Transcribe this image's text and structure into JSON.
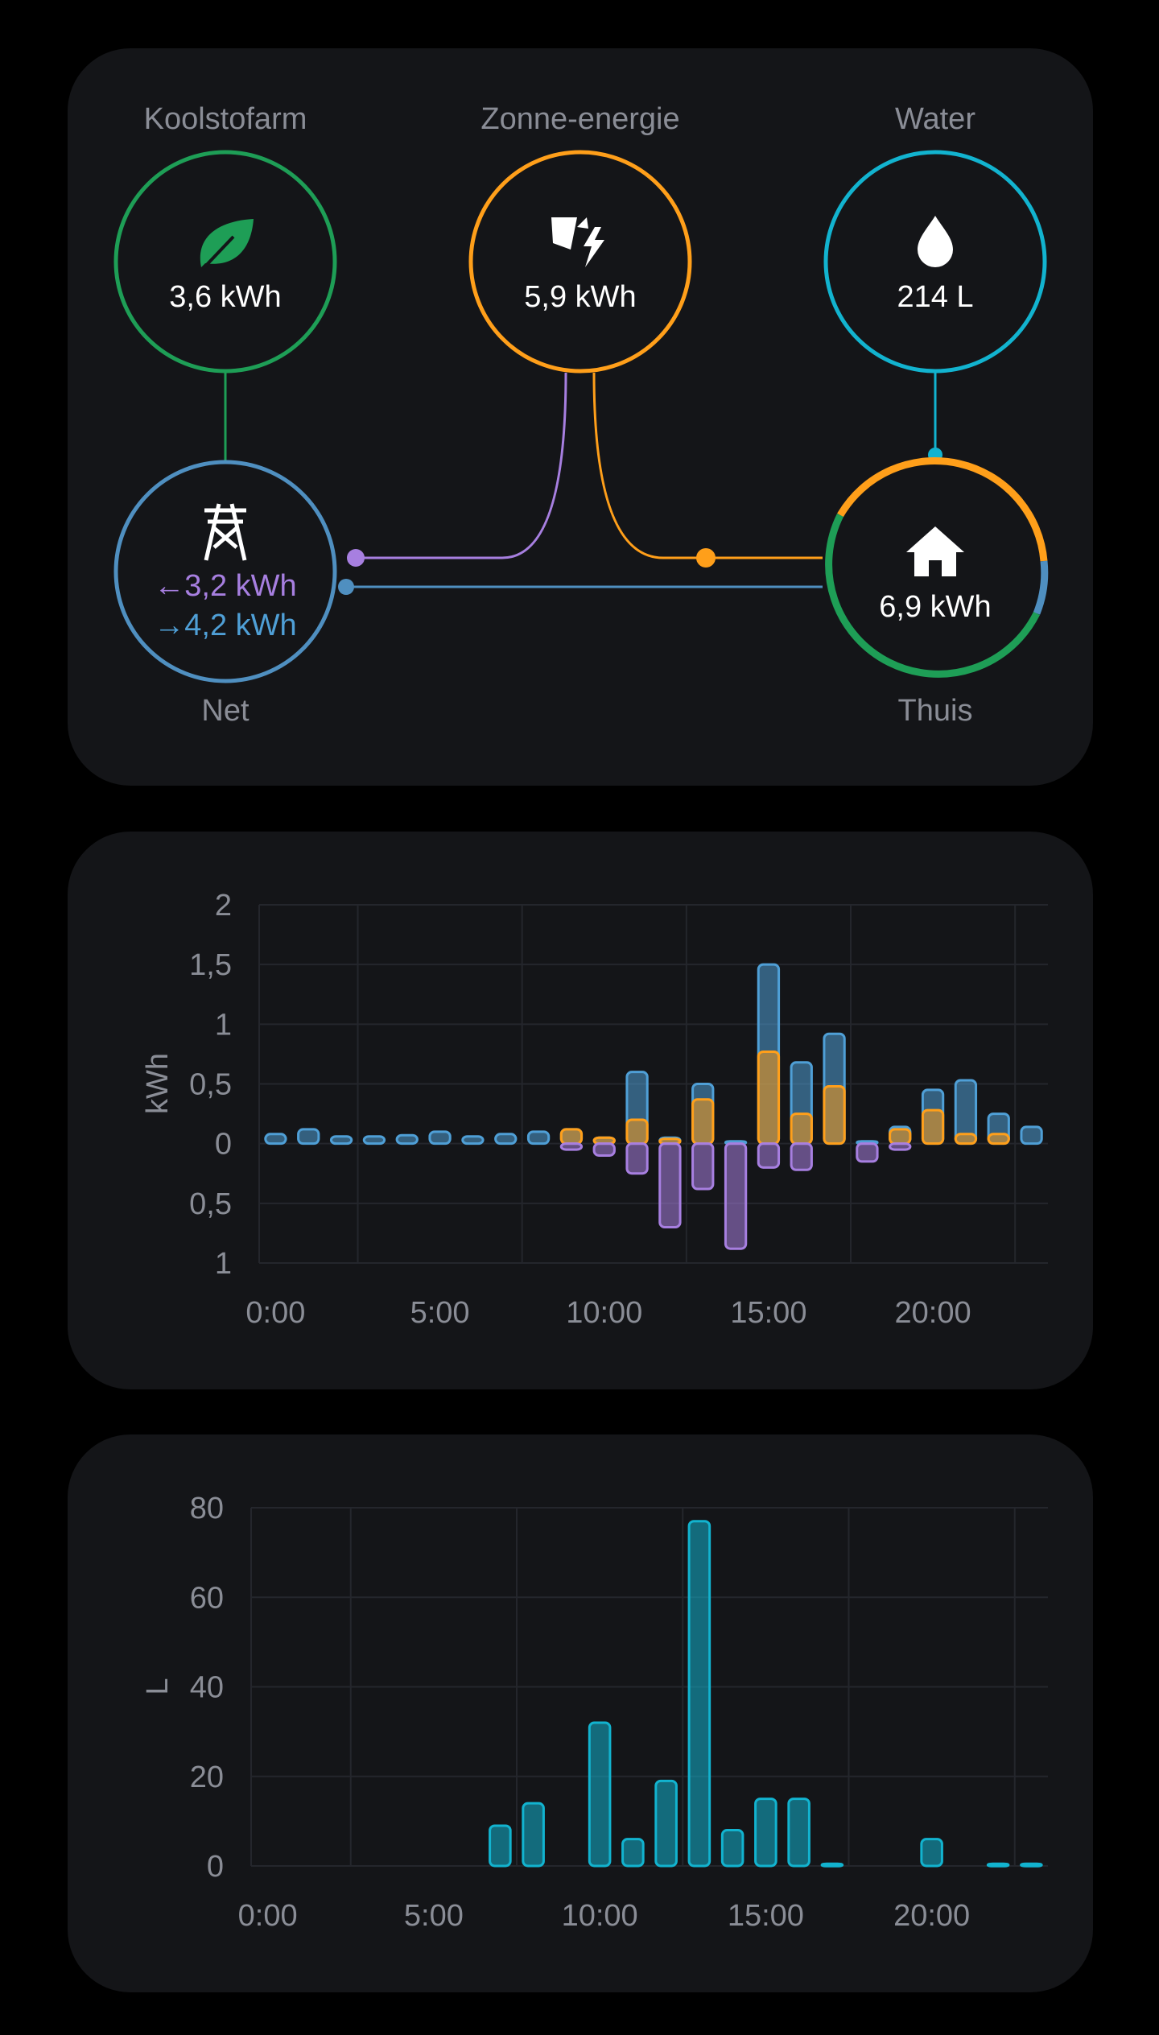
{
  "energy_flow": {
    "fossil": {
      "label": "Koolstofarm",
      "value": "3,6 kWh",
      "icon": "leaf-icon",
      "color": "#1e9e56"
    },
    "solar": {
      "label": "Zonne-energie",
      "value": "5,9 kWh",
      "icon": "solar-power-icon",
      "color": "#ff9f1a"
    },
    "water": {
      "label": "Water",
      "value": "214 L",
      "icon": "water-drop-icon",
      "color": "#12b3cf"
    },
    "grid": {
      "label": "Net",
      "import_arrow": "←",
      "import_value": "3,2 kWh",
      "export_arrow": "→",
      "export_value": "4,2 kWh",
      "icon": "transmission-tower-icon",
      "color": "#4f8fc0",
      "import_color": "#a77fe0",
      "export_color": "#4f9fd6"
    },
    "home": {
      "label": "Thuis",
      "value": "6,9 kWh",
      "icon": "home-icon"
    }
  },
  "chart_data": [
    {
      "type": "bar",
      "ylabel": "kWh",
      "x_tick_labels": [
        "0:00",
        "5:00",
        "10:00",
        "15:00",
        "20:00"
      ],
      "y_tick_labels": [
        "2",
        "1,5",
        "1",
        "0,5",
        "0",
        "0,5",
        "1"
      ],
      "ylim": [
        -1,
        2
      ],
      "categories": [
        0,
        1,
        2,
        3,
        4,
        5,
        6,
        7,
        8,
        9,
        10,
        11,
        12,
        13,
        14,
        15,
        16,
        17,
        18,
        19,
        20,
        21,
        22,
        23
      ],
      "series": [
        {
          "color": "#4f9fd6",
          "values": [
            0.08,
            0.12,
            0.06,
            0.06,
            0.07,
            0.1,
            0.06,
            0.08,
            0.1,
            0.12,
            0.05,
            0.6,
            0.05,
            0.5,
            0.02,
            1.5,
            0.68,
            0.92,
            0.02,
            0.14,
            0.45,
            0.53,
            0.25,
            0.14
          ]
        },
        {
          "color": "#ff9f1a",
          "values": [
            0,
            0,
            0,
            0,
            0,
            0,
            0,
            0,
            0,
            0.12,
            0.05,
            0.2,
            0.04,
            0.37,
            0,
            0.77,
            0.25,
            0.48,
            0,
            0.12,
            0.28,
            0.08,
            0.08,
            0
          ]
        },
        {
          "color": "#a77fe0",
          "values": [
            0,
            0,
            0,
            0,
            0,
            0,
            0,
            0,
            0,
            -0.05,
            -0.1,
            -0.25,
            -0.7,
            -0.38,
            -0.88,
            -0.2,
            -0.22,
            0,
            -0.15,
            -0.05,
            0,
            0,
            0,
            0
          ]
        }
      ],
      "grid": true
    },
    {
      "type": "bar",
      "ylabel": "L",
      "x_tick_labels": [
        "0:00",
        "5:00",
        "10:00",
        "15:00",
        "20:00"
      ],
      "y_tick_labels": [
        "80",
        "60",
        "40",
        "20",
        "0"
      ],
      "ylim": [
        0,
        80
      ],
      "categories": [
        0,
        1,
        2,
        3,
        4,
        5,
        6,
        7,
        8,
        9,
        10,
        11,
        12,
        13,
        14,
        15,
        16,
        17,
        18,
        19,
        20,
        21,
        22,
        23
      ],
      "series": [
        {
          "color": "#12b3cf",
          "values": [
            0,
            0,
            0,
            0,
            0,
            0,
            0,
            9,
            14,
            0,
            32,
            6,
            19,
            77,
            8,
            15,
            15,
            0.5,
            0,
            0,
            6,
            0,
            0.5,
            0.5
          ]
        }
      ],
      "grid": true
    }
  ]
}
